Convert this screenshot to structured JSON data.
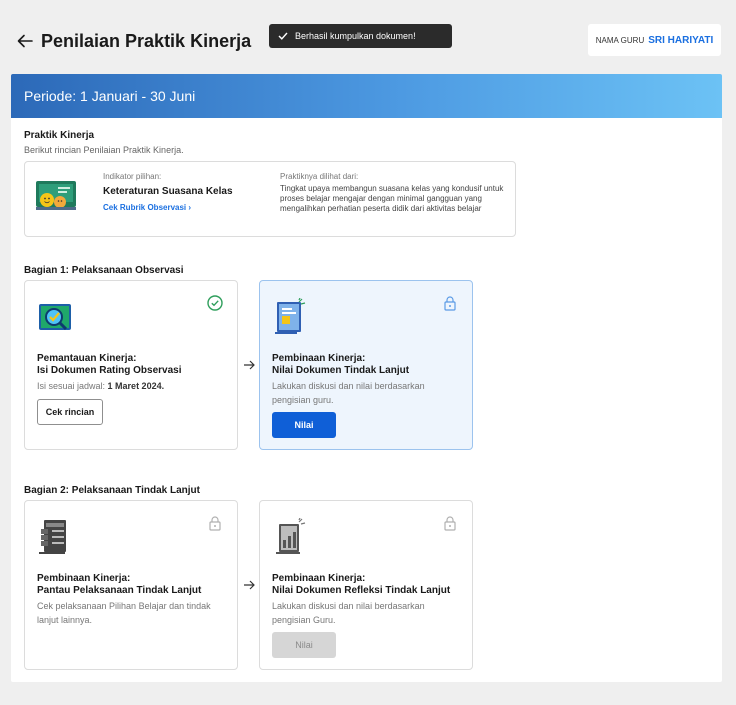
{
  "header": {
    "title": "Penilaian Praktik Kinerja",
    "teacher_label": "NAMA GURU",
    "teacher_name": "SRI HARIYATI"
  },
  "toast": {
    "message": "Berhasil kumpulkan dokumen!"
  },
  "period": {
    "label": "Periode: 1 Januari - 30 Juni"
  },
  "practice": {
    "title": "Praktik Kinerja",
    "subtitle": "Berikut rincian Penilaian Praktik Kinerja.",
    "indicator_label": "Indikator pilihan:",
    "indicator_name": "Keteraturan Suasana Kelas",
    "rubric_link": "Cek Rubrik Observasi  ›",
    "seen_label": "Praktiknya dilihat dari:",
    "seen_desc": "Tingkat upaya membangun suasana kelas yang kondusif untuk proses belajar mengajar dengan minimal gangguan yang mengalihkan perhatian peserta didik dari aktivitas belajar"
  },
  "section1": {
    "title": "Bagian 1: Pelaksanaan Observasi",
    "card1": {
      "title1": "Pemantauan Kinerja:",
      "title2": "Isi Dokumen Rating Observasi",
      "desc_prefix": "Isi sesuai jadwal: ",
      "desc_date": "1 Maret 2024.",
      "button": "Cek rincian"
    },
    "card2": {
      "title1": "Pembinaan Kinerja:",
      "title2": "Nilai Dokumen Tindak Lanjut",
      "desc": "Lakukan diskusi dan nilai berdasarkan pengisian guru.",
      "button": "Nilai"
    }
  },
  "section2": {
    "title": "Bagian 2: Pelaksanaan Tindak Lanjut",
    "card1": {
      "title1": "Pembinaan Kinerja:",
      "title2": "Pantau Pelaksanaan Tindak Lanjut",
      "desc": "Cek pelaksanaan Pilihan Belajar dan tindak lanjut lainnya."
    },
    "card2": {
      "title1": "Pembinaan Kinerja:",
      "title2": "Nilai Dokumen Refleksi Tindak Lanjut",
      "desc": "Lakukan diskusi dan nilai berdasarkan pengisian Guru.",
      "button": "Nilai"
    }
  },
  "colors": {
    "primary": "#0f5fd7",
    "success": "#2e9e5b",
    "banner_start": "#2c69b8",
    "banner_end": "#6cc2f5"
  },
  "icons": [
    "back-arrow-icon",
    "check-icon",
    "checkmark-circle-icon",
    "lock-icon",
    "arrow-right-icon",
    "chevron-right-icon"
  ]
}
